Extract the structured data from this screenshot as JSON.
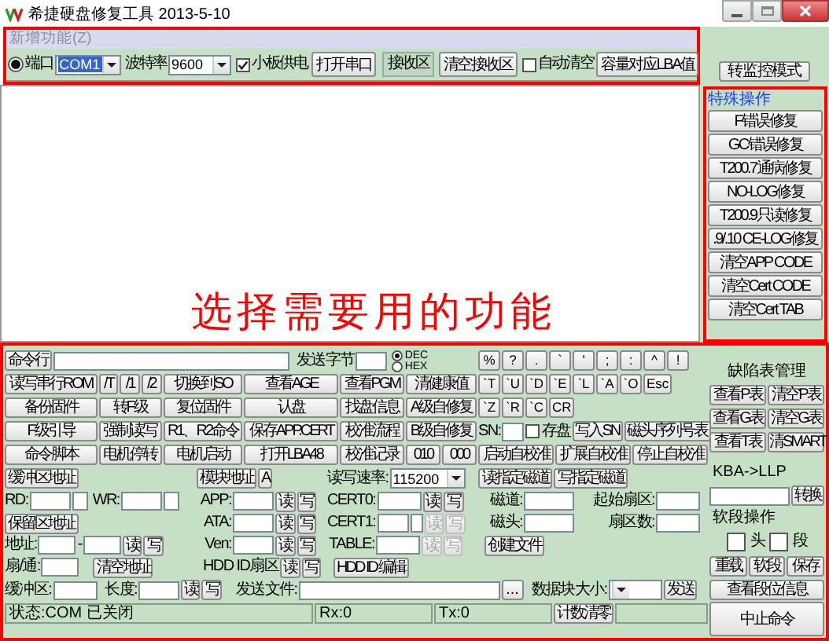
{
  "window": {
    "title": "希捷硬盘修复工具 2013-5-10"
  },
  "menu": [
    {
      "label": "新增功能(Z)",
      "disabled": true
    }
  ],
  "toolbar": {
    "port_radio": {
      "selected": true
    },
    "port_label": "端口",
    "port_value": "COM1",
    "baud_label": "波特率",
    "baud_value": "9600",
    "power": {
      "label": "小板供电",
      "checked": true
    },
    "open_port": "打开串口",
    "receive_label": "接收区",
    "clear_receive": "清空接收区",
    "auto_clear": {
      "label": "自动清空",
      "checked": false
    },
    "capacity_lba": "容量对应LBA值"
  },
  "caption": "选择需要用的功能",
  "side": {
    "monitor_button": "转监控模式",
    "special_title": "特殊操作",
    "special_buttons": [
      "F错误修复",
      "GC错误修复",
      "T200.7通病修复",
      "NO-LOG修复",
      "T200.9只读修复",
      ".9/.10 CE-LOG修复",
      "清空APP CODE",
      "清空Cert CODE",
      "清空Cert TAB"
    ]
  },
  "console": {
    "command_button": "命令行",
    "send_bytes_label": "发送字节",
    "radix": [
      {
        "label": "DEC",
        "selected": true
      },
      {
        "label": "HEX",
        "selected": false
      }
    ],
    "function_rows": [
      [
        [
          "读写串行ROM"
        ],
        [
          "/T",
          "/1",
          "/2"
        ],
        [
          "切换到SO"
        ],
        [
          "查看AGE"
        ],
        [
          "查看PGM"
        ],
        [
          "清健康值"
        ]
      ],
      [
        [
          "备份固件"
        ],
        [
          "转F级"
        ],
        [
          "复位固件"
        ],
        [
          "认盘"
        ],
        [
          "找盘信息"
        ],
        [
          "A级自修复"
        ]
      ],
      [
        [
          "F级引导"
        ],
        [
          "强制读写"
        ],
        [
          "R1、R2命令"
        ],
        [
          "保存APP.CERT"
        ],
        [
          "校准流程"
        ],
        [
          "B级自修复"
        ]
      ],
      [
        [
          "命令脚本"
        ],
        [
          "电机停转"
        ],
        [
          "电机启动"
        ],
        [
          "打开LBA48"
        ],
        [
          "校准记录"
        ],
        [
          "010",
          "000"
        ]
      ]
    ],
    "keys": [
      [
        "%",
        "?",
        ".",
        "`",
        "'",
        ";",
        ":",
        "^",
        "!"
      ],
      [
        "`T",
        "`U",
        "`D",
        "`E",
        "`L",
        "`A",
        "`O",
        "Esc"
      ],
      [
        "`Z",
        "`R",
        "`C",
        "CR"
      ]
    ],
    "sn_label": "SN:",
    "save_disk": {
      "label": "存盘",
      "checked": false
    },
    "write_sn": "写入SN",
    "head_serial_table": "磁头序列号表",
    "self_calibration": [
      "启动自校准",
      "扩展自校准",
      "停止自校准"
    ],
    "buffer_address": "缓冲区地址",
    "module_address": "模块地址",
    "module_a": "A",
    "rate_label": "读写速率:",
    "rate_value": "115200",
    "track_read": "读指定磁道",
    "track_write": "写指定磁道",
    "rd_label": "RD:",
    "wr_label": "WR:",
    "reserved_address": "保留区地址",
    "address_label": "地址:",
    "address_dash": "-",
    "address_read": "读",
    "address_write": "写",
    "sector_label": "扇/通:",
    "clear_address": "清空地址",
    "io_rows": [
      {
        "kind": "field",
        "label": "APP:",
        "read": {
          "label": "读",
          "disabled": false
        },
        "write": {
          "label": "写",
          "disabled": false
        }
      },
      {
        "kind": "field",
        "label": "ATA:",
        "read": {
          "label": "读",
          "disabled": false
        },
        "write": {
          "label": "写",
          "disabled": false
        }
      },
      {
        "kind": "field",
        "label": "Ven:",
        "read": {
          "label": "读",
          "disabled": false
        },
        "write": {
          "label": "写",
          "disabled": false
        }
      },
      {
        "kind": "text",
        "label": "HDD ID扇区",
        "read": {
          "label": "读",
          "disabled": false
        },
        "write": {
          "label": "写",
          "disabled": false
        }
      }
    ],
    "cert_rows": [
      {
        "kind": "single",
        "label": "CERT0:",
        "read": {
          "label": "读",
          "disabled": false
        },
        "write": {
          "label": "写",
          "disabled": false
        }
      },
      {
        "kind": "double",
        "label": "CERT1:",
        "read": {
          "label": "读",
          "disabled": true
        },
        "write": {
          "label": "写",
          "disabled": true
        }
      },
      {
        "kind": "single",
        "label": "TABLE:",
        "read": {
          "label": "读",
          "disabled": true
        },
        "write": {
          "label": "写",
          "disabled": true
        }
      }
    ],
    "hdd_id_edit": "HDD ID 编辑",
    "track_label": "磁道:",
    "start_sector_label": "起始扇区:",
    "head_label": "磁头:",
    "sector_count_label": "扇区数:",
    "create_file": "创建文件",
    "buffer_label": "缓冲区:",
    "length_label": "长度:",
    "length_read": "读",
    "length_write": "写",
    "send_file_label": "发送文件:",
    "browse": "...",
    "block_size_label": "数据块大小:",
    "send": "发送",
    "defect_title": "缺陷表管理",
    "defect_buttons": [
      [
        "查看P表",
        "清空P表"
      ],
      [
        "查看G表",
        "清空G表"
      ],
      [
        "查看T表",
        "清SMART"
      ]
    ],
    "kba_label": "KBA->LLP",
    "convert": "转换",
    "soft_title": "软段操作",
    "soft_checks": [
      {
        "label": "头",
        "checked": false
      },
      {
        "label": "段",
        "checked": false
      }
    ],
    "soft_buttons": [
      "重载",
      "软段",
      "保存"
    ],
    "segment_info": "查看段位信息",
    "abort": "中止命令"
  },
  "status": [
    {
      "kind": "panel",
      "text": "状态:COM 已关闭"
    },
    {
      "kind": "panel",
      "text": "Rx:0"
    },
    {
      "kind": "panel",
      "text": "Tx:0"
    },
    {
      "kind": "button",
      "text": "计数清零"
    }
  ]
}
